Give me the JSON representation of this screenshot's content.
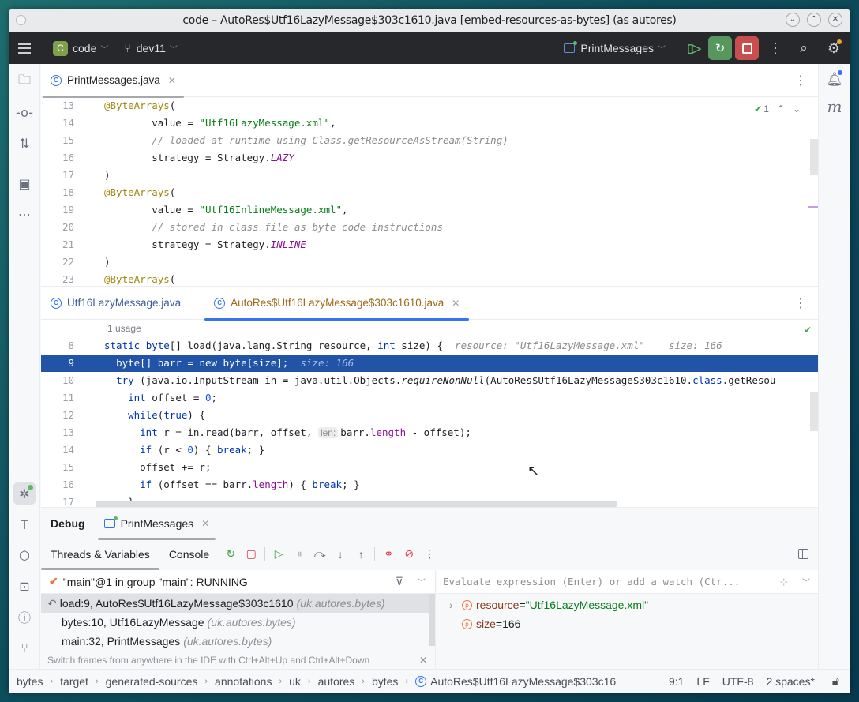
{
  "window": {
    "title": "code – AutoRes$Utf16LazyMessage$303c1610.java [embed-resources-as-bytes] (as autores)",
    "controls": [
      "minimize",
      "maximize",
      "close"
    ]
  },
  "toolbar": {
    "project_badge": "C",
    "project_name": "code",
    "branch": "dev11",
    "run_config": "PrintMessages"
  },
  "left_strip": {
    "top": [
      "folder-icon",
      "commit-icon",
      "pull-request-icon",
      "structure-icon",
      "more-icon"
    ],
    "bottom": [
      "debug-icon",
      "build-icon",
      "services-icon",
      "terminal-icon",
      "problems-icon",
      "git-icon"
    ]
  },
  "top_editor": {
    "tabs": [
      {
        "label": "PrintMessages.java",
        "closable": true
      }
    ],
    "inspection_count": "1",
    "lines": [
      {
        "n": "13",
        "html": "<span class=\"ann\">@ByteArrays</span>("
      },
      {
        "n": "14",
        "html": "        value = <span class=\"str\">\"Utf16LazyMessage.xml\"</span>,"
      },
      {
        "n": "15",
        "html": "        <span class=\"cmt\">// loaded at runtime using Class.getResourceAsStream(String)</span>"
      },
      {
        "n": "16",
        "html": "        strategy = Strategy.<span class=\"enum\">LAZY</span>"
      },
      {
        "n": "17",
        "html": ")"
      },
      {
        "n": "18",
        "html": "<span class=\"ann\">@ByteArrays</span>("
      },
      {
        "n": "19",
        "html": "        value = <span class=\"str\">\"Utf16InlineMessage.xml\"</span>,"
      },
      {
        "n": "20",
        "html": "        <span class=\"cmt\">// stored in class file as byte code instructions</span>"
      },
      {
        "n": "21",
        "html": "        strategy = Strategy.<span class=\"enum\">INLINE</span>"
      },
      {
        "n": "22",
        "html": ")"
      },
      {
        "n": "23",
        "html": "<span class=\"ann\">@ByteArrays</span>("
      }
    ]
  },
  "bottom_editor": {
    "tabs": [
      {
        "label": "Utf16LazyMessage.java",
        "closable": false
      },
      {
        "label": "AutoRes$Utf16LazyMessage$303c1610.java",
        "closable": true
      }
    ],
    "usage_hint": "1 usage",
    "lines": [
      {
        "n": "8",
        "html": "<span class=\"kw\">static</span> <span class=\"kw\">byte</span>[] load(java.lang.String resource, <span class=\"kw\">int</span> size) {  <span class=\"hint\">resource: \"Utf16LazyMessage.xml\"    size: 166</span>"
      },
      {
        "n": "9",
        "html": "  <span class=\"kw\">byte</span>[] barr = <span class=\"kw\">new</span> <span class=\"kw\">byte</span>[size];  <span class=\"hint\">size: 166</span>",
        "exec": true
      },
      {
        "n": "10",
        "html": "  <span class=\"kw\">try</span> (java.io.InputStream in = java.util.Objects.<span class=\"ital\">requireNonNull</span>(AutoRes$Utf16LazyMessage$303c1610.<span class=\"kw\">class</span>.getResou"
      },
      {
        "n": "11",
        "html": "    <span class=\"kw\">int</span> offset = <span class=\"num\">0</span>;"
      },
      {
        "n": "12",
        "html": "    <span class=\"kw\">while</span>(<span class=\"kw\">true</span>) {"
      },
      {
        "n": "13",
        "html": "      <span class=\"kw\">int</span> r = in.read(barr, offset, <span class=\"inlay\">len:</span>barr.<span class=\"fld\">length</span> - offset);"
      },
      {
        "n": "14",
        "html": "      <span class=\"kw\">if</span> (r &lt; <span class=\"num\">0</span>) { <span class=\"kw\">break</span>; }"
      },
      {
        "n": "15",
        "html": "      offset += r;"
      },
      {
        "n": "16",
        "html": "      <span class=\"kw\">if</span> (offset == barr.<span class=\"fld\">length</span>) { <span class=\"kw\">break</span>; }"
      },
      {
        "n": "17",
        "html": "    }"
      }
    ]
  },
  "debug": {
    "title": "Debug",
    "session_tab": "PrintMessages",
    "sub_tabs": [
      "Threads & Variables",
      "Console"
    ],
    "tools": [
      "rerun-icon",
      "stop-icon",
      "resume-icon",
      "pause-icon",
      "step-over-icon",
      "step-into-icon",
      "step-out-icon",
      "view-breakpoints-icon",
      "mute-breakpoints-icon",
      "more-icon"
    ],
    "thread": "\"main\"@1 in group \"main\": RUNNING",
    "frames": [
      {
        "method": "load:9, AutoRes$Utf16LazyMessage$303c1610",
        "pkg": "(uk.autores.bytes)",
        "selected": true
      },
      {
        "method": "bytes:10, Utf16LazyMessage",
        "pkg": "(uk.autores.bytes)",
        "selected": false
      },
      {
        "method": "main:32, PrintMessages",
        "pkg": "(uk.autores.bytes)",
        "selected": false
      }
    ],
    "frames_tip": "Switch frames from anywhere in the IDE with Ctrl+Alt+Up and Ctrl+Alt+Down",
    "eval_placeholder": "Evaluate expression (Enter) or add a watch (Ctr...",
    "variables": [
      {
        "name": "resource",
        "value": "\"Utf16LazyMessage.xml\"",
        "is_string": true,
        "expandable": true
      },
      {
        "name": "size",
        "value": "166",
        "is_string": false,
        "expandable": false
      }
    ]
  },
  "statusbar": {
    "breadcrumbs": [
      "bytes",
      "target",
      "generated-sources",
      "annotations",
      "uk",
      "autores",
      "bytes"
    ],
    "file": "AutoRes$Utf16LazyMessage$303c16",
    "position": "9:1",
    "line_sep": "LF",
    "encoding": "UTF-8",
    "indent": "2 spaces*"
  }
}
